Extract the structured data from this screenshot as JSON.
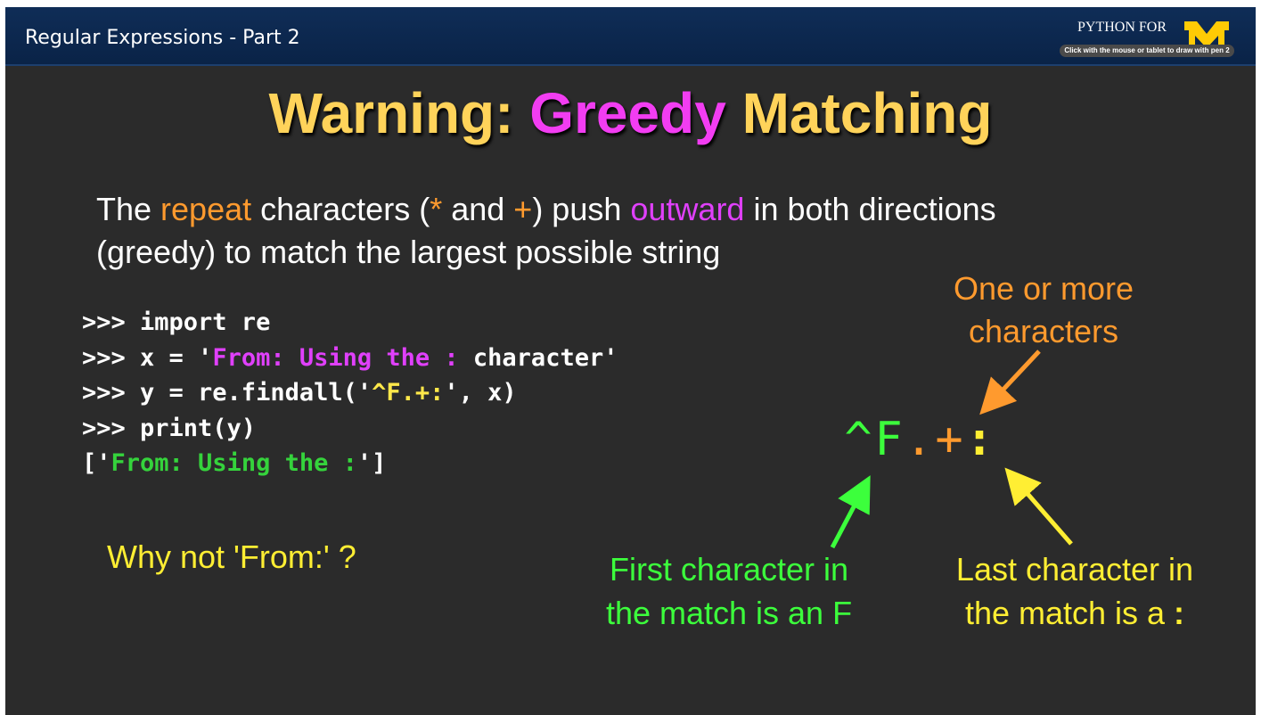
{
  "header": {
    "lecture_title": "Regular Expressions - Part 2",
    "brand_text": "PYTHON FOR",
    "hint": "Click with the mouse or tablet to draw with pen 2"
  },
  "slide": {
    "title_part1": "Warning: ",
    "title_highlight": "Greedy",
    "title_part2": " Matching",
    "desc": {
      "t1": "The ",
      "t2": "repeat",
      "t3": " characters (",
      "t4": "*",
      "t5": " and ",
      "t6": "+",
      "t7": ") push ",
      "t8": "outward",
      "t9": " in both directions",
      "line2": "(greedy) to match the largest possible string"
    },
    "code": {
      "l1": ">>> import re",
      "l2a": ">>> x = '",
      "l2b": "From: Using the :",
      "l2c": " character'",
      "l3a": ">>> y = re.findall('",
      "l3b": "^F.+:",
      "l3c": "', x)",
      "l4": ">>> print(y)",
      "l5a": "['",
      "l5b": "From: Using the :",
      "l5c": "']"
    },
    "question": "Why not 'From:' ?",
    "pattern": {
      "caret": "^",
      "f": "F",
      "dot": ".",
      "plus": "+",
      "colon": ":"
    },
    "annotations": {
      "orange_l1": "One or more",
      "orange_l2": "characters",
      "green_l1": "First character in",
      "green_l2": "the match is an F",
      "yellow_l1": "Last character in",
      "yellow_l2": "the match is a ",
      "yellow_colon": ":"
    }
  },
  "colors": {
    "title": "#ffd35a",
    "highlight": "#f23df2",
    "orange": "#ff9a2e",
    "green": "#3cff3c",
    "yellow": "#ffee33",
    "background": "#2b2b2b",
    "topbar": "#0f2d57"
  }
}
